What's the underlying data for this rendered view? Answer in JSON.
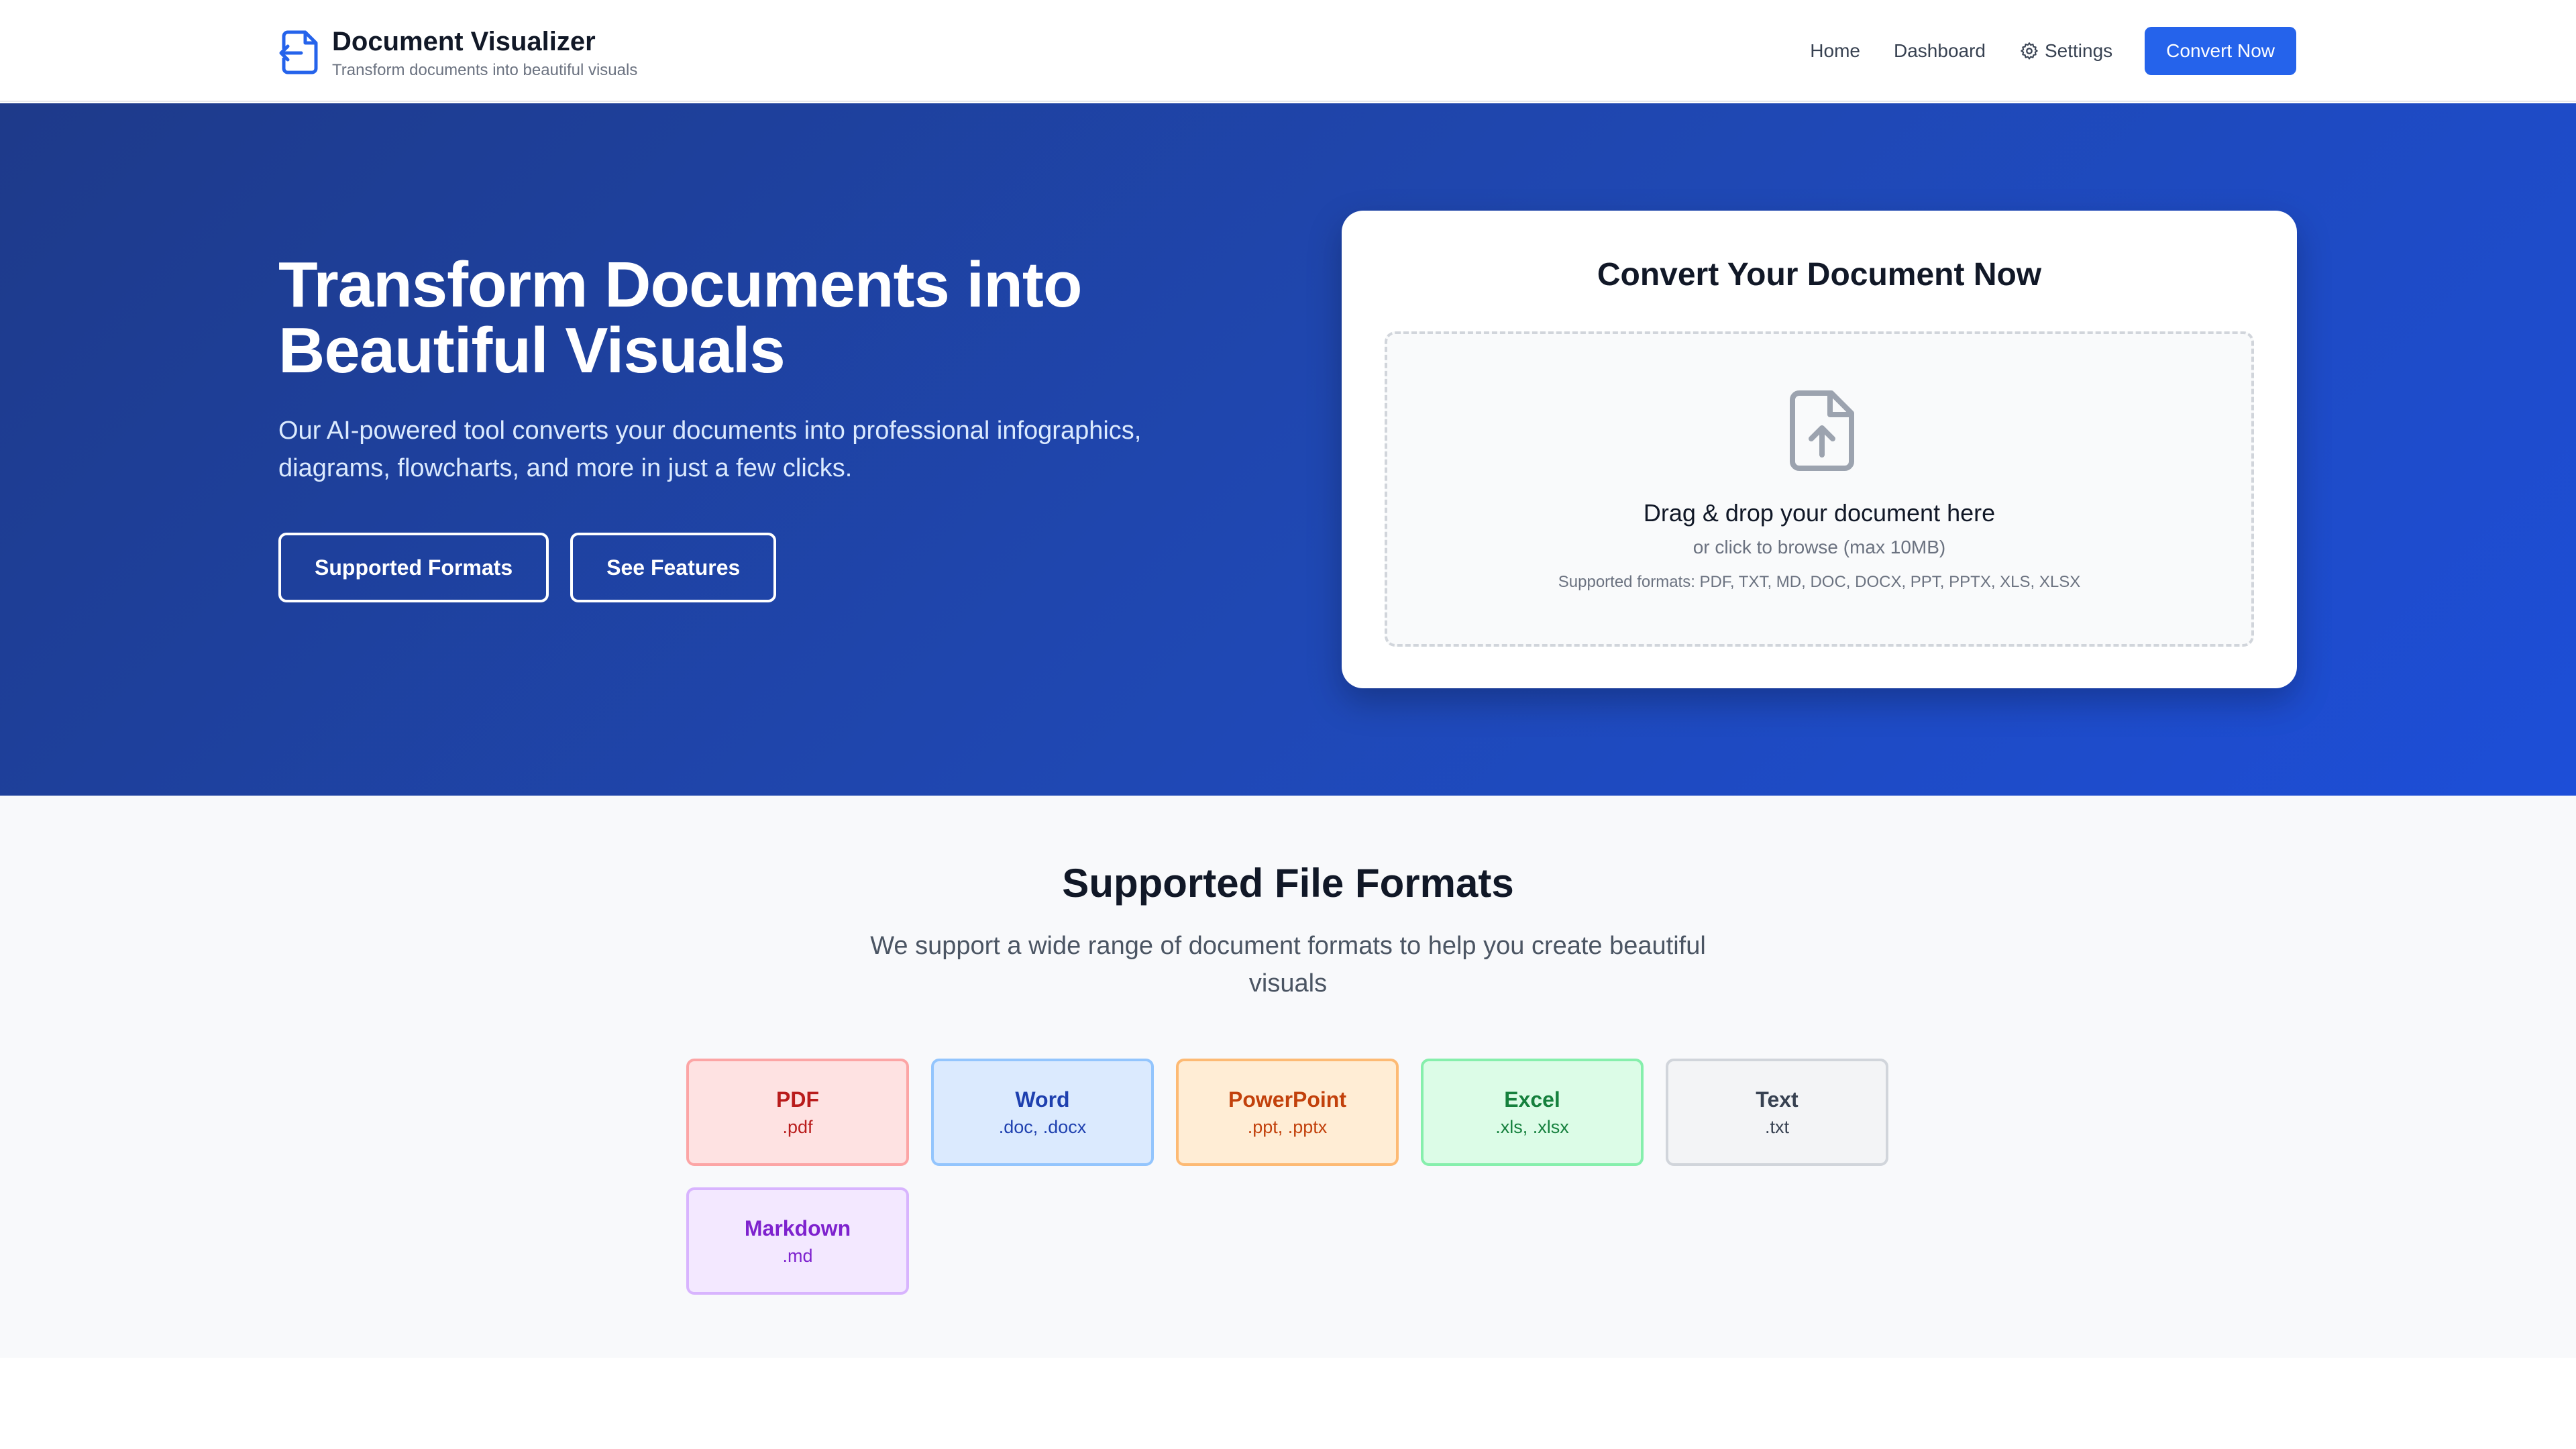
{
  "brand": {
    "title": "Document Visualizer",
    "subtitle": "Transform documents into beautiful visuals",
    "icon": "file-export-icon"
  },
  "nav": {
    "home": "Home",
    "dashboard": "Dashboard",
    "settings": "Settings",
    "convert": "Convert Now"
  },
  "hero": {
    "title": "Transform Documents into Beautiful Visuals",
    "description": "Our AI-powered tool converts your documents into professional infographics, diagrams, flowcharts, and more in just a few clicks.",
    "buttons": {
      "formats": "Supported Formats",
      "features": "See Features"
    }
  },
  "upload": {
    "title": "Convert Your Document Now",
    "drop_text": "Drag & drop your document here",
    "browse_text": "or click to browse (max 10MB)",
    "formats_text": "Supported formats: PDF, TXT, MD, DOC, DOCX, PPT, PPTX, XLS, XLSX",
    "icon": "file-upload-icon"
  },
  "formats": {
    "title": "Supported File Formats",
    "description": "We support a wide range of document formats to help you create beautiful visuals",
    "items": [
      {
        "name": "PDF",
        "ext": ".pdf",
        "bg": "#fee2e2",
        "border": "#fca5a5",
        "color": "#b91c1c"
      },
      {
        "name": "Word",
        "ext": ".doc, .docx",
        "bg": "#dbeafe",
        "border": "#93c5fd",
        "color": "#1e40af"
      },
      {
        "name": "PowerPoint",
        "ext": ".ppt, .pptx",
        "bg": "#ffedd5",
        "border": "#fdba74",
        "color": "#c2410c"
      },
      {
        "name": "Excel",
        "ext": ".xls, .xlsx",
        "bg": "#dcfce7",
        "border": "#86efac",
        "color": "#15803d"
      },
      {
        "name": "Text",
        "ext": ".txt",
        "bg": "#f3f4f6",
        "border": "#d1d5db",
        "color": "#374151"
      },
      {
        "name": "Markdown",
        "ext": ".md",
        "bg": "#f3e8ff",
        "border": "#d8b4fe",
        "color": "#7e22ce"
      }
    ]
  },
  "colors": {
    "accent": "#2563eb",
    "hero_gradient_start": "#1e3a8a",
    "hero_gradient_end": "#1d4ed8"
  }
}
